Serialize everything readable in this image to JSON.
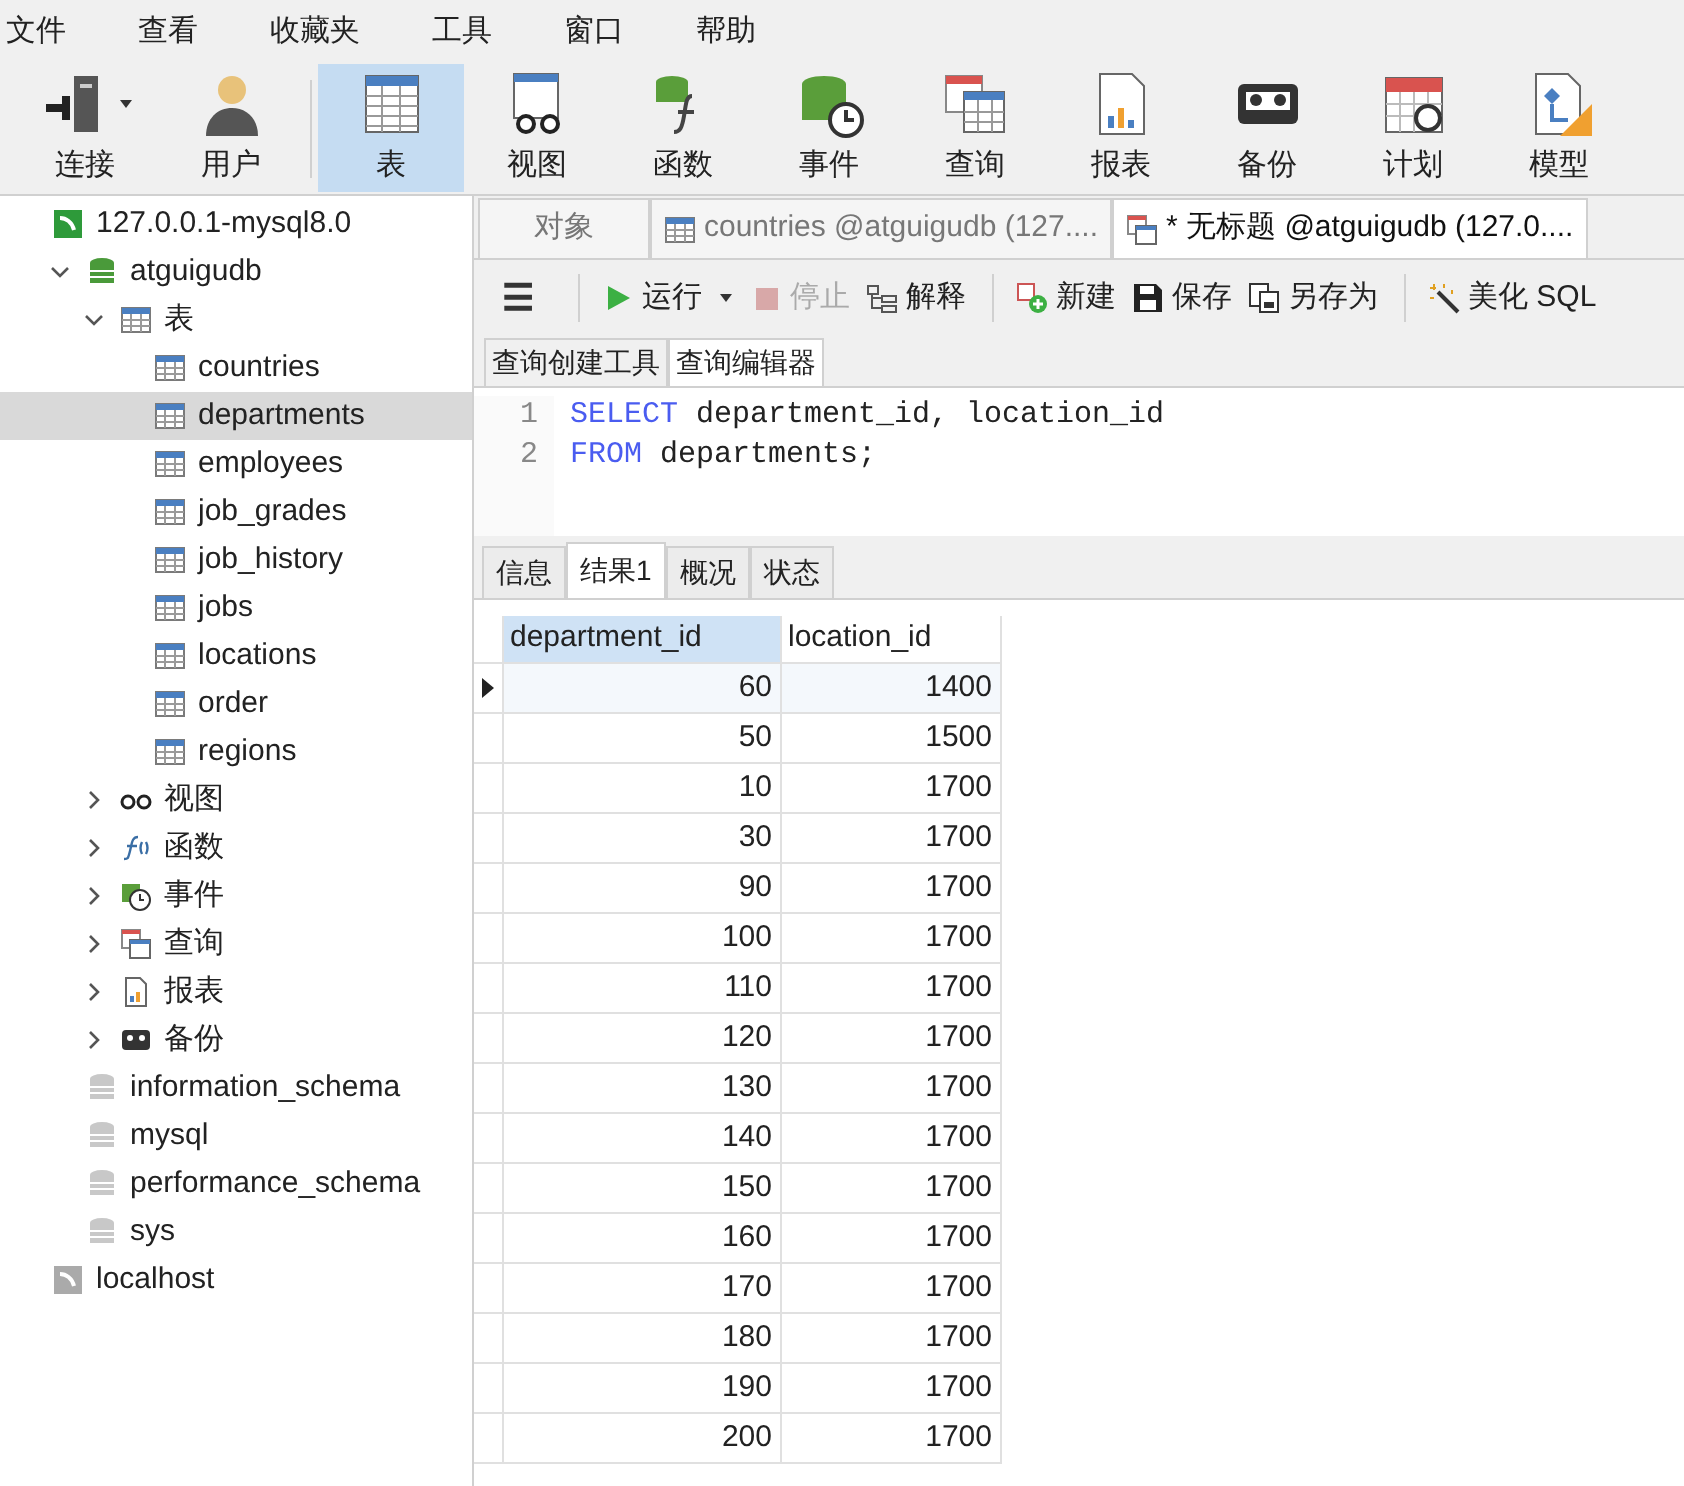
{
  "menu": [
    "文件",
    "查看",
    "收藏夹",
    "工具",
    "窗口",
    "帮助"
  ],
  "toolbar": [
    {
      "kind": "connect",
      "label": "连接",
      "selected": false
    },
    {
      "kind": "user",
      "label": "用户",
      "selected": false
    },
    {
      "kind": "table",
      "label": "表",
      "selected": true
    },
    {
      "kind": "view",
      "label": "视图",
      "selected": false
    },
    {
      "kind": "function",
      "label": "函数",
      "selected": false
    },
    {
      "kind": "event",
      "label": "事件",
      "selected": false
    },
    {
      "kind": "query",
      "label": "查询",
      "selected": false
    },
    {
      "kind": "report",
      "label": "报表",
      "selected": false
    },
    {
      "kind": "backup",
      "label": "备份",
      "selected": false
    },
    {
      "kind": "schedule",
      "label": "计划",
      "selected": false
    },
    {
      "kind": "model",
      "label": "模型",
      "selected": false
    }
  ],
  "tree": [
    {
      "kind": "server",
      "label": "127.0.0.1-mysql8.0",
      "selected": false,
      "children": [
        {
          "kind": "database",
          "label": "atguigudb",
          "selected": false,
          "expanded": true,
          "children": [
            {
              "kind": "tables",
              "label": "表",
              "selected": false,
              "expanded": true,
              "children": [
                {
                  "kind": "table",
                  "label": "countries",
                  "selected": false
                },
                {
                  "kind": "table",
                  "label": "departments",
                  "selected": true
                },
                {
                  "kind": "table",
                  "label": "employees",
                  "selected": false
                },
                {
                  "kind": "table",
                  "label": "job_grades",
                  "selected": false
                },
                {
                  "kind": "table",
                  "label": "job_history",
                  "selected": false
                },
                {
                  "kind": "table",
                  "label": "jobs",
                  "selected": false
                },
                {
                  "kind": "table",
                  "label": "locations",
                  "selected": false
                },
                {
                  "kind": "table",
                  "label": "order",
                  "selected": false
                },
                {
                  "kind": "table",
                  "label": "regions",
                  "selected": false
                }
              ]
            },
            {
              "kind": "views",
              "label": "视图",
              "selected": false,
              "expanded": false
            },
            {
              "kind": "functions",
              "label": "函数",
              "selected": false,
              "expanded": false
            },
            {
              "kind": "events",
              "label": "事件",
              "selected": false,
              "expanded": false
            },
            {
              "kind": "queries",
              "label": "查询",
              "selected": false,
              "expanded": false
            },
            {
              "kind": "reports",
              "label": "报表",
              "selected": false,
              "expanded": false
            },
            {
              "kind": "backups",
              "label": "备份",
              "selected": false,
              "expanded": false
            }
          ]
        },
        {
          "kind": "database-closed",
          "label": "information_schema",
          "selected": false
        },
        {
          "kind": "database-closed",
          "label": "mysql",
          "selected": false
        },
        {
          "kind": "database-closed",
          "label": "performance_schema",
          "selected": false
        },
        {
          "kind": "database-closed",
          "label": "sys",
          "selected": false
        }
      ]
    },
    {
      "kind": "server-closed",
      "label": "localhost",
      "selected": false
    }
  ],
  "doc_tabs": [
    {
      "kind": "plain",
      "label": "对象",
      "selected": false
    },
    {
      "kind": "table",
      "label": "countries @atguigudb (127....",
      "selected": false
    },
    {
      "kind": "query",
      "label": "* 无标题 @atguigudb (127.0....",
      "selected": true
    }
  ],
  "editor_toolbar": [
    {
      "kind": "menu",
      "label": "☰",
      "disabled": false
    },
    {
      "kind": "run",
      "label": "运行",
      "disabled": false
    },
    {
      "kind": "stop",
      "label": "停止",
      "disabled": true
    },
    {
      "kind": "explain",
      "label": "解释",
      "disabled": false
    },
    {
      "kind": "new",
      "label": "新建",
      "disabled": false
    },
    {
      "kind": "save",
      "label": "保存",
      "disabled": false
    },
    {
      "kind": "saveas",
      "label": "另存为",
      "disabled": false
    },
    {
      "kind": "beautify",
      "label": "美化 SQL",
      "disabled": false
    }
  ],
  "editor_tabs": [
    {
      "label": "查询创建工具",
      "selected": false
    },
    {
      "label": "查询编辑器",
      "selected": true
    }
  ],
  "code": [
    {
      "number": "1",
      "keyword": "SELECT",
      "rest": " department_id, location_id"
    },
    {
      "number": "2",
      "keyword": "FROM",
      "rest": " departments;"
    }
  ],
  "result_tabs": [
    {
      "label": "信息",
      "selected": false
    },
    {
      "label": "结果1",
      "selected": true
    },
    {
      "label": "概况",
      "selected": false
    },
    {
      "label": "状态",
      "selected": false
    }
  ],
  "table": {
    "columns": [
      {
        "label": "department_id",
        "selected": true
      },
      {
        "label": "location_id",
        "selected": false
      }
    ],
    "rows": [
      {
        "selected": true,
        "cells": [
          "60",
          "1400"
        ]
      },
      {
        "selected": false,
        "cells": [
          "50",
          "1500"
        ]
      },
      {
        "selected": false,
        "cells": [
          "10",
          "1700"
        ]
      },
      {
        "selected": false,
        "cells": [
          "30",
          "1700"
        ]
      },
      {
        "selected": false,
        "cells": [
          "90",
          "1700"
        ]
      },
      {
        "selected": false,
        "cells": [
          "100",
          "1700"
        ]
      },
      {
        "selected": false,
        "cells": [
          "110",
          "1700"
        ]
      },
      {
        "selected": false,
        "cells": [
          "120",
          "1700"
        ]
      },
      {
        "selected": false,
        "cells": [
          "130",
          "1700"
        ]
      },
      {
        "selected": false,
        "cells": [
          "140",
          "1700"
        ]
      },
      {
        "selected": false,
        "cells": [
          "150",
          "1700"
        ]
      },
      {
        "selected": false,
        "cells": [
          "160",
          "1700"
        ]
      },
      {
        "selected": false,
        "cells": [
          "170",
          "1700"
        ]
      },
      {
        "selected": false,
        "cells": [
          "180",
          "1700"
        ]
      },
      {
        "selected": false,
        "cells": [
          "190",
          "1700"
        ]
      },
      {
        "selected": false,
        "cells": [
          "200",
          "1700"
        ]
      }
    ]
  }
}
